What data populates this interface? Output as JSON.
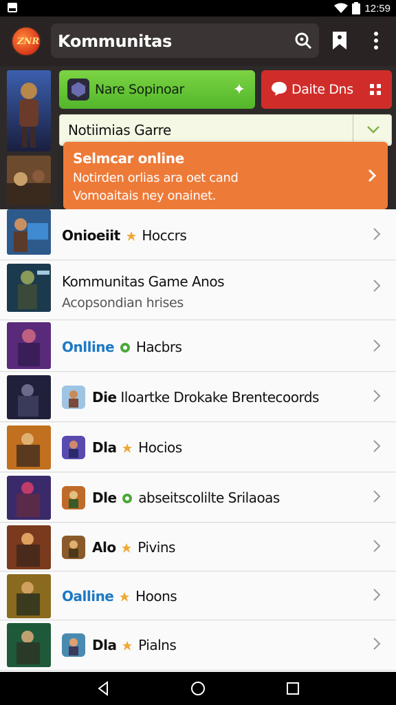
{
  "status_bar": {
    "time": "12:59"
  },
  "app_bar": {
    "logo_text": "ZNR",
    "title": "Kommunitas"
  },
  "actions": {
    "green_button": "Nare Sopinoar",
    "red_button": "Daite Dns"
  },
  "dropdown": {
    "selected": "Notiimias Garre"
  },
  "notification": {
    "title": "Selmcar online",
    "line1": "Notirden orlias ara oet cand",
    "line2": "Vomoaitais ney onainet."
  },
  "list": [
    {
      "title": "Onioeiit",
      "meta": "Hoccrs",
      "badge": "star"
    },
    {
      "title": "Kommunitas Game Anos",
      "sub": "Acopsondian hrises"
    },
    {
      "title": "Onlline",
      "meta": "Hacbrs",
      "title_style": "blue",
      "badge": "leaf"
    },
    {
      "title": "Die",
      "meta": "Iloartke Drokake Brentecoords"
    },
    {
      "title": "Dla",
      "meta": "Hocios",
      "badge": "star"
    },
    {
      "title": "Dle",
      "meta": "abseitscolilte Srilaoas",
      "badge": "leaf"
    },
    {
      "title": "Alo",
      "meta": "Pivins",
      "badge": "star"
    },
    {
      "title": "Oalline",
      "meta": "Hoons",
      "title_style": "blue",
      "badge": "star"
    },
    {
      "title": "Dla",
      "meta": "Pialns",
      "badge": "star"
    }
  ],
  "colors": {
    "appbar": "#2a2323",
    "green": "#5cbc30",
    "red": "#d02d2a",
    "orange": "#ee7a38",
    "link_blue": "#1d79c4"
  }
}
